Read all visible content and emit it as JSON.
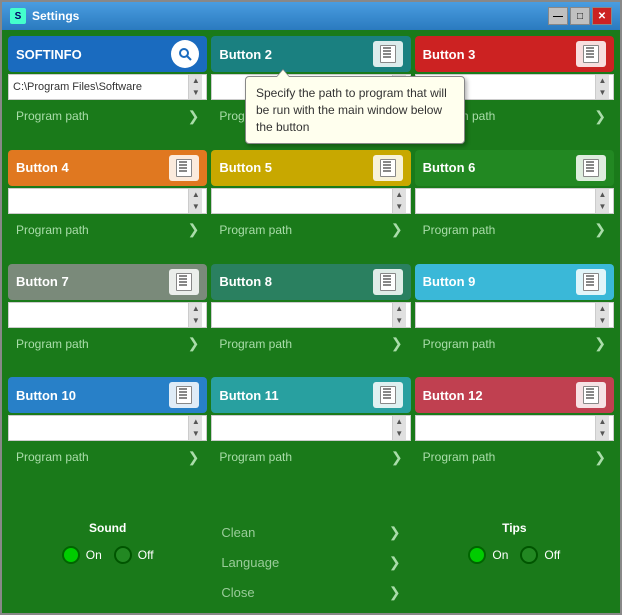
{
  "window": {
    "title": "Settings",
    "icon": "S"
  },
  "tooltip": {
    "text": "Specify the path to program that will be run with the main window below the button"
  },
  "buttons": [
    {
      "id": 1,
      "label": "SOFTINFO",
      "color": "bg-blue",
      "path": "C:\\Program Files\\Software",
      "special": "softinfo"
    },
    {
      "id": 2,
      "label": "Button 2",
      "color": "bg-teal",
      "path": "",
      "tooltip": true
    },
    {
      "id": 3,
      "label": "Button 3",
      "color": "bg-red",
      "path": ""
    },
    {
      "id": 4,
      "label": "Button 4",
      "color": "bg-orange",
      "path": ""
    },
    {
      "id": 5,
      "label": "Button 5",
      "color": "bg-yellow",
      "path": ""
    },
    {
      "id": 6,
      "label": "Button 6",
      "color": "bg-green",
      "path": ""
    },
    {
      "id": 7,
      "label": "Button 7",
      "color": "bg-gray",
      "path": ""
    },
    {
      "id": 8,
      "label": "Button 8",
      "color": "bg-darkgreen",
      "path": ""
    },
    {
      "id": 9,
      "label": "Button 9",
      "color": "bg-lightblue",
      "path": ""
    },
    {
      "id": 10,
      "label": "Button 10",
      "color": "bg-blue2",
      "path": ""
    },
    {
      "id": 11,
      "label": "Button 11",
      "color": "bg-teal2",
      "path": ""
    },
    {
      "id": 12,
      "label": "Button 12",
      "color": "bg-rose",
      "path": ""
    }
  ],
  "program_path_label": "Program path",
  "bottom": {
    "sound_label": "Sound",
    "tips_label": "Tips",
    "on_label": "On",
    "off_label": "Off",
    "menu_items": [
      {
        "label": "Clean",
        "id": "clean"
      },
      {
        "label": "Language",
        "id": "language"
      },
      {
        "label": "Close",
        "id": "close"
      }
    ]
  },
  "title_buttons": {
    "minimize": "—",
    "maximize": "□",
    "close": "✕"
  }
}
